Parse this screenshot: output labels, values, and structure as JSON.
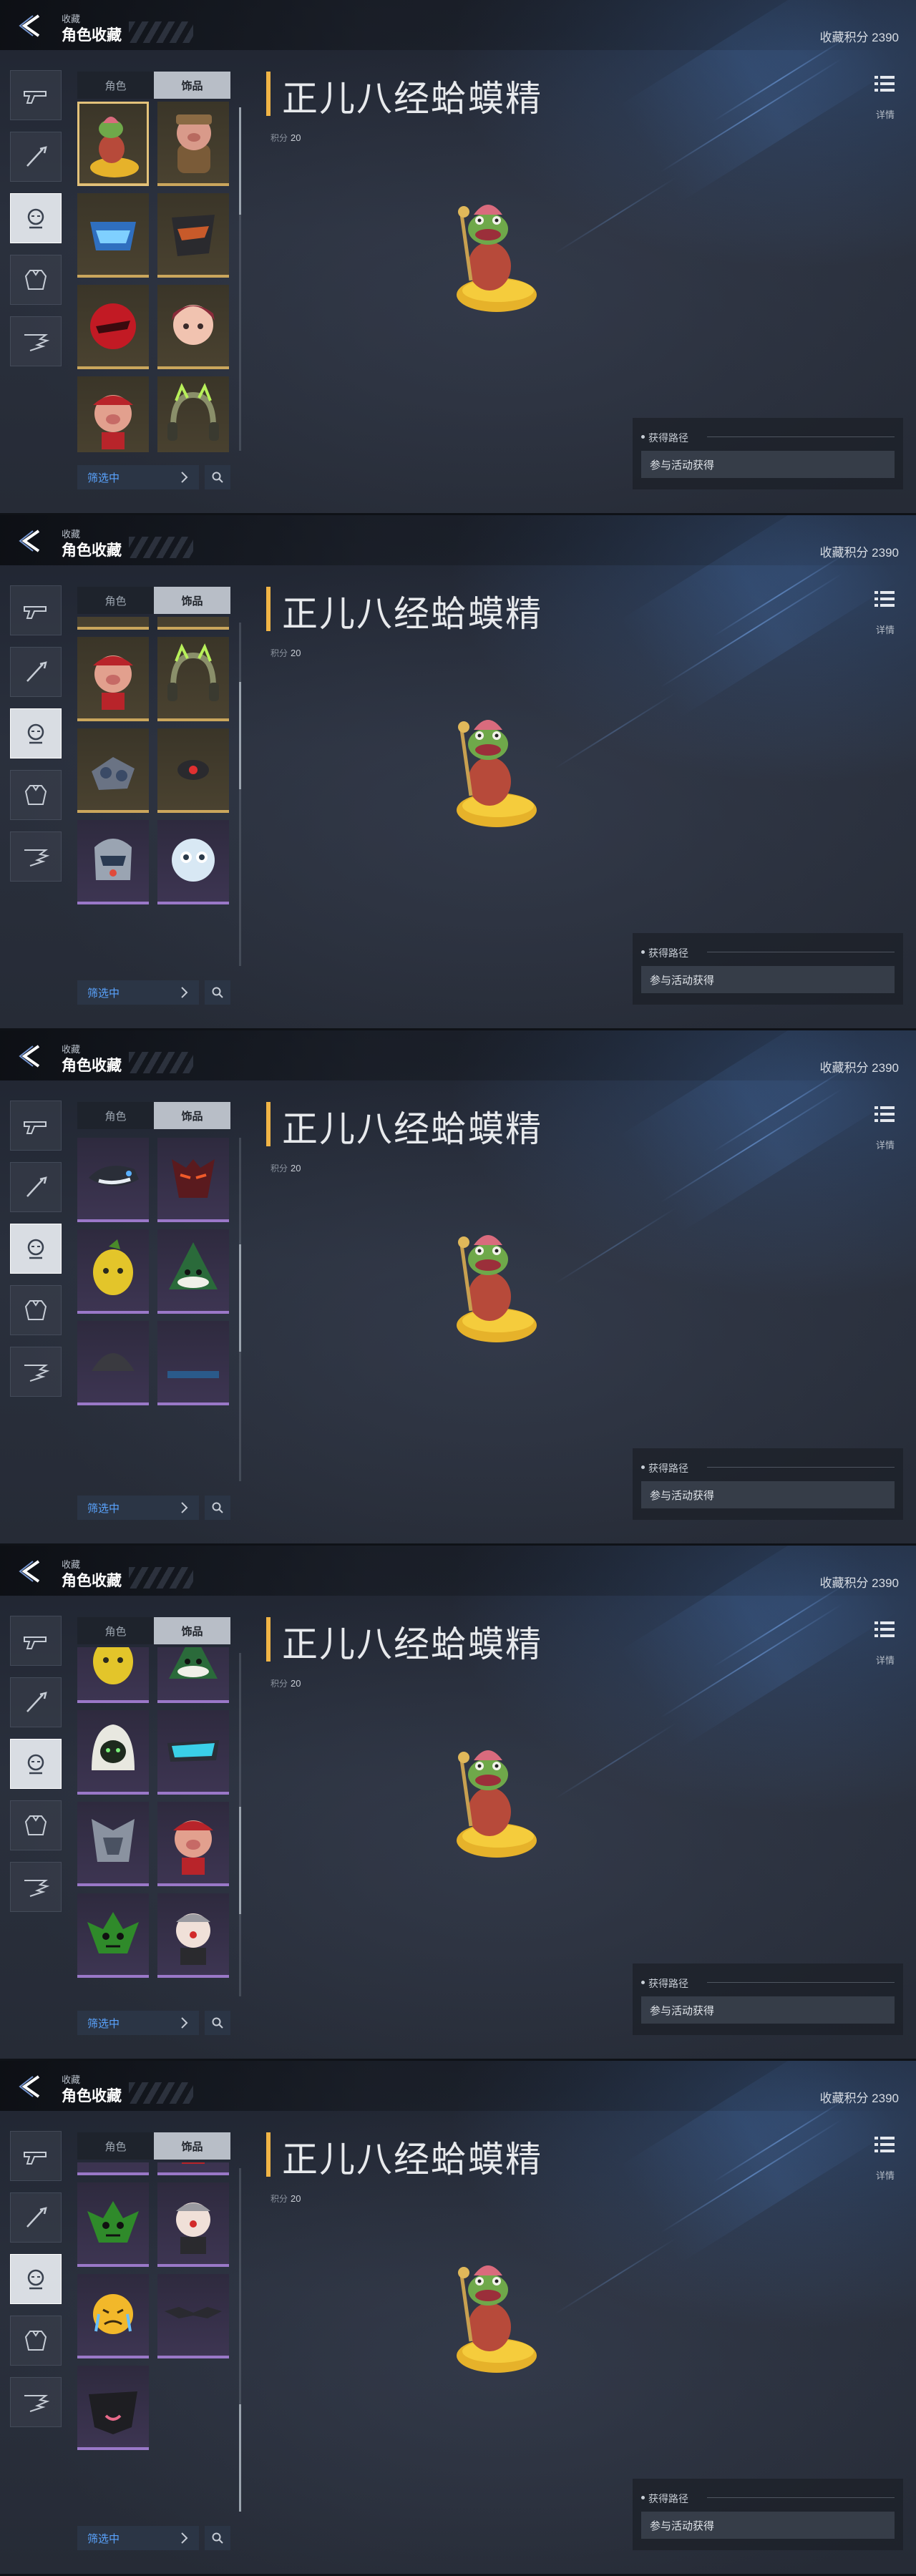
{
  "header": {
    "breadcrumb": "收藏",
    "title": "角色收藏",
    "score_text": "收藏积分 2390"
  },
  "sidebar": {
    "categories": [
      {
        "name": "weapon",
        "icon": "gun-icon"
      },
      {
        "name": "melee",
        "icon": "knife-icon"
      },
      {
        "name": "character",
        "icon": "head-icon",
        "active": true
      },
      {
        "name": "armor",
        "icon": "armor-icon"
      },
      {
        "name": "other",
        "icon": "wing-icon"
      }
    ]
  },
  "tabs": [
    {
      "label": "角色",
      "active": false
    },
    {
      "label": "饰品",
      "active": true
    }
  ],
  "filter": {
    "label": "筛选中"
  },
  "detail": {
    "item_name": "正儿八经蛤蟆精",
    "points_label": "积分",
    "points_value": "20",
    "detail_label": "详情",
    "source_title": "获得路径",
    "source_value": "参与活动获得"
  },
  "colors": {
    "accent_gold": "#f0b446",
    "filter_blue": "#5aa4ff",
    "rarity_gold": "#caa65c",
    "rarity_purple": "#9a78c8"
  },
  "screens": [
    {
      "scroll": 0.0,
      "items": [
        {
          "icon": "toad-figure-icon",
          "rarity": "gold",
          "selected": true
        },
        {
          "icon": "pig-doll-icon",
          "rarity": "gold"
        },
        {
          "icon": "blue-mask-icon",
          "rarity": "gold"
        },
        {
          "icon": "dark-mask-icon",
          "rarity": "gold"
        },
        {
          "icon": "red-hood-icon",
          "rarity": "gold"
        },
        {
          "icon": "girl-head-icon",
          "rarity": "gold"
        },
        {
          "icon": "red-pig-icon",
          "rarity": "gold"
        },
        {
          "icon": "cat-headphones-icon",
          "rarity": "gold"
        }
      ]
    },
    {
      "scroll": 0.25,
      "items": [
        {
          "icon": "red-hood-icon",
          "rarity": "gold"
        },
        {
          "icon": "girl-head-icon",
          "rarity": "gold"
        },
        {
          "icon": "red-pig-icon",
          "rarity": "gold"
        },
        {
          "icon": "cat-headphones-icon",
          "rarity": "gold"
        },
        {
          "icon": "mech-gauntlet-icon",
          "rarity": "gold"
        },
        {
          "icon": "red-eye-drone-icon",
          "rarity": "gold"
        },
        {
          "icon": "robot-helmet-icon",
          "rarity": "purple"
        },
        {
          "icon": "white-ball-icon",
          "rarity": "purple"
        }
      ]
    },
    {
      "scroll": 0.45,
      "items": [
        {
          "icon": "robot-helmet-icon",
          "rarity": "purple"
        },
        {
          "icon": "white-ball-icon",
          "rarity": "purple"
        },
        {
          "icon": "orca-drone-icon",
          "rarity": "purple"
        },
        {
          "icon": "demon-mask-icon",
          "rarity": "purple"
        },
        {
          "icon": "yellow-fruit-icon",
          "rarity": "purple"
        },
        {
          "icon": "green-dumpling-icon",
          "rarity": "purple"
        },
        {
          "icon": "dark-helmet-icon",
          "rarity": "purple"
        },
        {
          "icon": "blue-visor-icon",
          "rarity": "purple"
        }
      ]
    },
    {
      "scroll": 0.65,
      "items": [
        {
          "icon": "yellow-fruit-icon",
          "rarity": "purple"
        },
        {
          "icon": "green-dumpling-icon",
          "rarity": "purple"
        },
        {
          "icon": "white-hood-icon",
          "rarity": "purple"
        },
        {
          "icon": "cyan-visor-icon",
          "rarity": "purple"
        },
        {
          "icon": "silver-armor-icon",
          "rarity": "purple"
        },
        {
          "icon": "red-pig-icon",
          "rarity": "purple"
        },
        {
          "icon": "green-gremlin-icon",
          "rarity": "purple"
        },
        {
          "icon": "clown-icon",
          "rarity": "purple"
        }
      ]
    },
    {
      "scroll": 1.0,
      "items": [
        {
          "icon": "silver-armor-icon",
          "rarity": "purple"
        },
        {
          "icon": "red-pig-icon",
          "rarity": "purple"
        },
        {
          "icon": "green-gremlin-icon",
          "rarity": "purple"
        },
        {
          "icon": "clown-icon",
          "rarity": "purple"
        },
        {
          "icon": "crying-emoji-icon",
          "rarity": "purple"
        },
        {
          "icon": "bat-mask-icon",
          "rarity": "purple"
        },
        {
          "icon": "black-mouth-mask-icon",
          "rarity": "purple"
        }
      ]
    }
  ]
}
